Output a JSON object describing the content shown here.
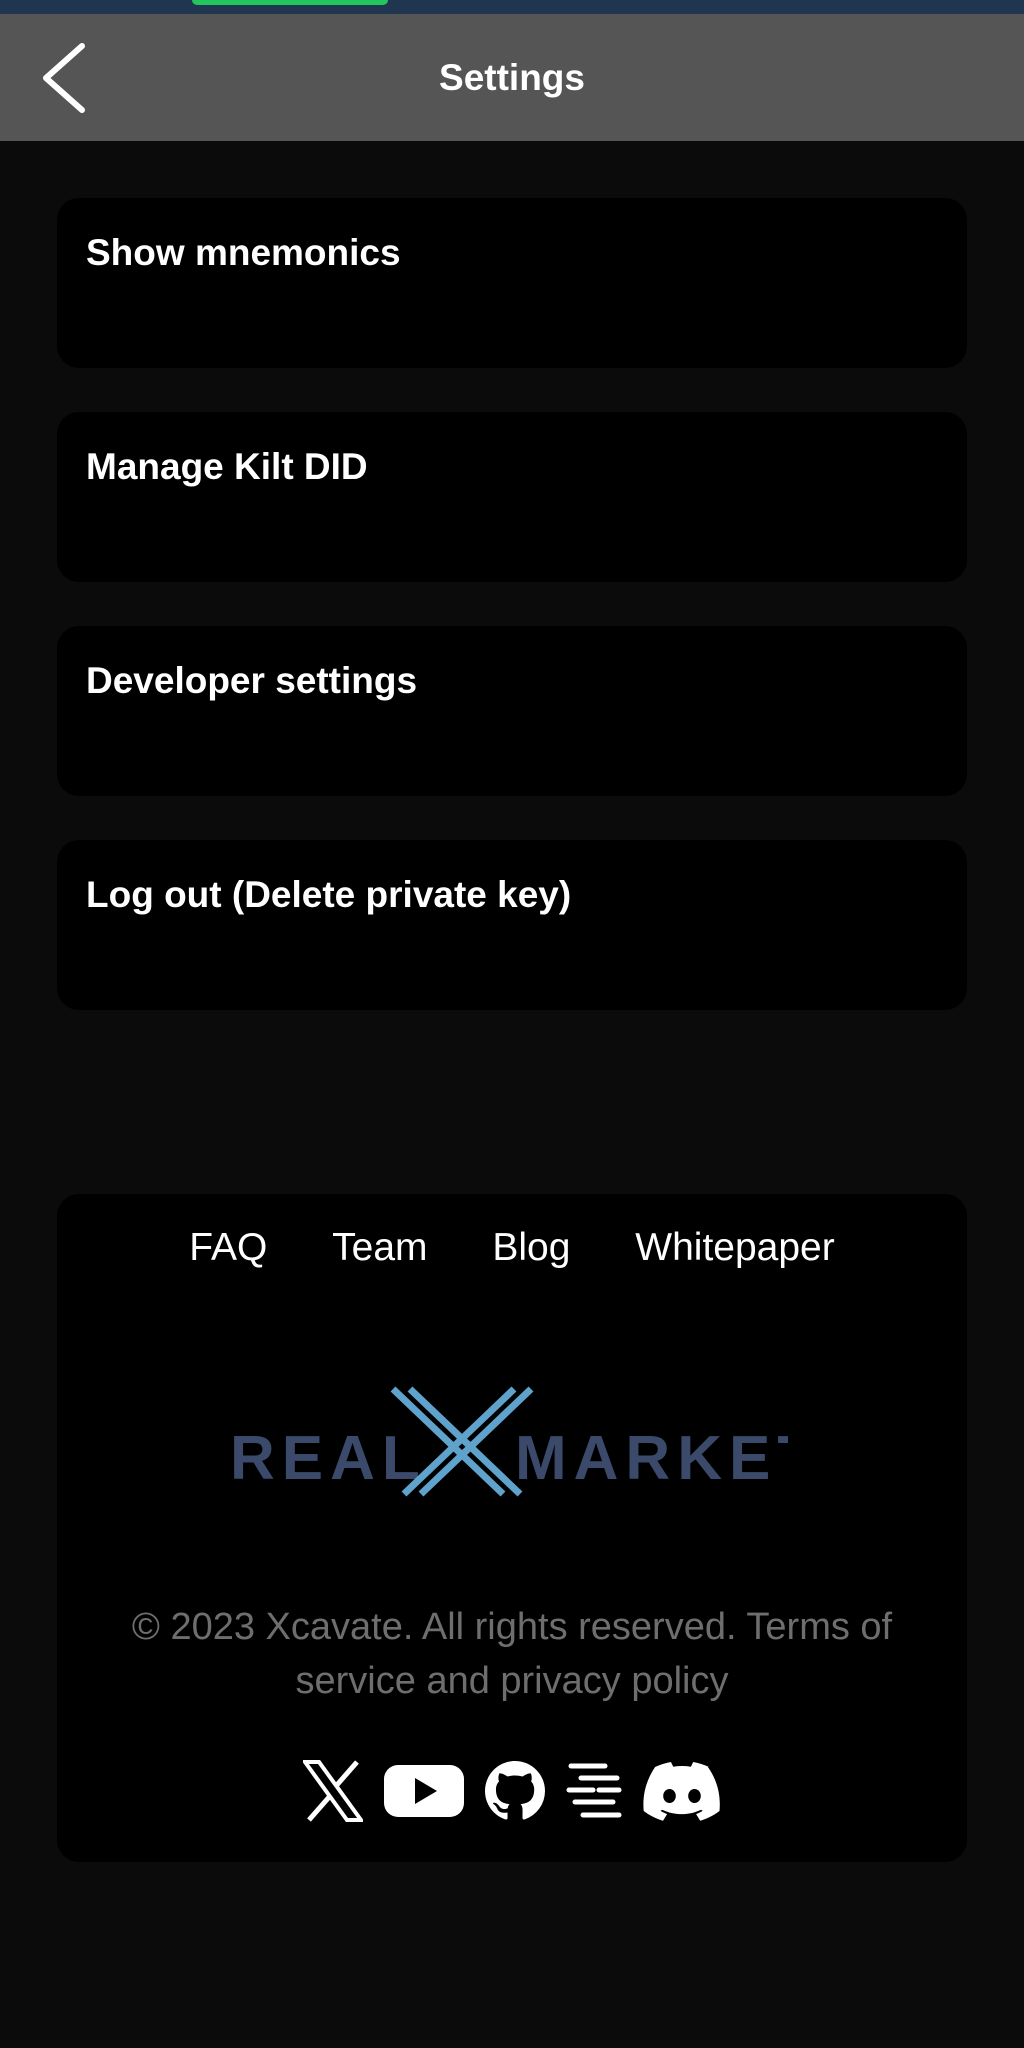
{
  "header": {
    "title": "Settings"
  },
  "settings_items": [
    {
      "label": "Show mnemonics"
    },
    {
      "label": "Manage Kilt DID"
    },
    {
      "label": "Developer settings"
    },
    {
      "label": "Log out (Delete private key)"
    }
  ],
  "footer": {
    "links": [
      "FAQ",
      "Team",
      "Blog",
      "Whitepaper"
    ],
    "logo": {
      "left_text": "REAL",
      "right_text": "MARKET",
      "text_color": "#3b4a6b",
      "x_color": "#5fa3cc"
    },
    "copyright": "© 2023 Xcavate. All rights reserved. Terms of service and privacy policy",
    "social_icons": [
      "x-icon",
      "youtube-icon",
      "github-icon",
      "subsocial-icon",
      "discord-icon"
    ]
  },
  "colors": {
    "background": "#0b0b0b",
    "header": "#555555",
    "card": "#000000",
    "status_bar": "#1f3550",
    "status_pill": "#22c55e",
    "copyright_text": "#6e6e6e"
  }
}
